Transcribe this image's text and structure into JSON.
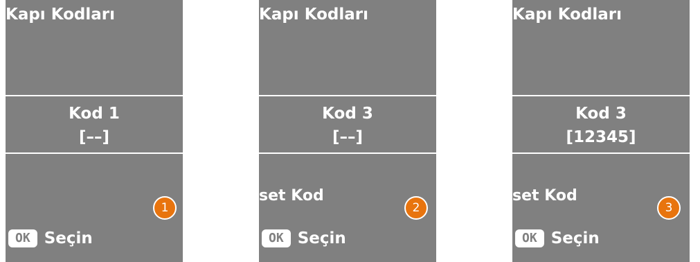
{
  "screens": [
    {
      "title": "Kapı Kodları",
      "code_name": "Kod 1",
      "code_value": "[––]",
      "set_label": "",
      "step": "1",
      "ok_key": "OK",
      "select_label": "Seçin"
    },
    {
      "title": "Kapı Kodları",
      "code_name": "Kod 3",
      "code_value": "[––]",
      "set_label": "set Kod",
      "step": "2",
      "ok_key": "OK",
      "select_label": "Seçin"
    },
    {
      "title": "Kapı Kodları",
      "code_name": "Kod 3",
      "code_value": "[12345]",
      "set_label": "set Kod",
      "step": "3",
      "ok_key": "OK",
      "select_label": "Seçin"
    }
  ],
  "colors": {
    "screen_background": "#808080",
    "text": "#ffffff",
    "step_badge": "#e8740e"
  }
}
